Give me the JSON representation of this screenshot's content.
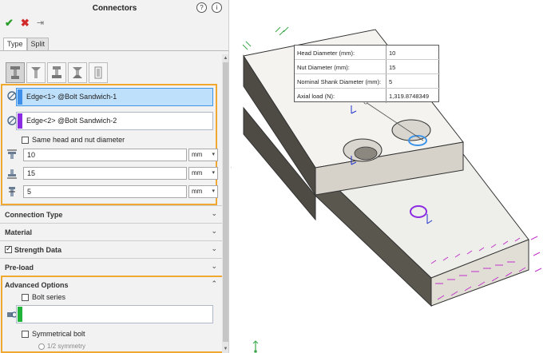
{
  "panel": {
    "title": "Connectors",
    "help_icon": "help-icon",
    "tooltip_icon": "tooltip-icon",
    "actions": {
      "ok": "✔",
      "cancel": "✖",
      "pin": "⇥"
    },
    "tabs": [
      {
        "label": "Type",
        "active": true
      },
      {
        "label": "Split",
        "active": false
      }
    ],
    "bolt_types": [
      "standard-bolt-icon",
      "countersink-bolt-icon",
      "counterbore-nut-icon",
      "countersink-nut-icon",
      "foundation-bolt-icon"
    ],
    "edge1": {
      "label": "Edge<1> @Bolt Sandwich-1",
      "color": "#3f8fe8"
    },
    "edge2": {
      "label": "Edge<2> @Bolt Sandwich-2",
      "color": "#8b2be2"
    },
    "same_diameter": {
      "label": "Same head and nut diameter",
      "checked": false
    },
    "head_diameter": {
      "value": "10",
      "unit": "mm"
    },
    "nut_diameter": {
      "value": "15",
      "unit": "mm"
    },
    "shank_diameter": {
      "value": "5",
      "unit": "mm"
    },
    "sections": {
      "connection_type": "Connection Type",
      "material": "Material",
      "strength_data": "Strength Data",
      "preload": "Pre-load",
      "advanced": "Advanced Options"
    },
    "strength_checked": true,
    "bolt_series": {
      "label": "Bolt series",
      "checked": false,
      "color": "#22b33a"
    },
    "symmetrical": {
      "label": "Symmetrical bolt",
      "checked": false
    },
    "half_symmetry": "1/2 symmetry"
  },
  "callout": {
    "rows": [
      {
        "label": "Head Diameter (mm):",
        "value": "10"
      },
      {
        "label": "Nut Diameter (mm):",
        "value": "15"
      },
      {
        "label": "Nominal Shank Diameter (mm):",
        "value": "5"
      },
      {
        "label": "Axial load (N):",
        "value": "1,319.8748349"
      }
    ]
  },
  "colors": {
    "accent_orange": "#f0a830",
    "selection_blue": "#3f95e8",
    "fixture_green": "#3aa84a",
    "load_magenta": "#c233c9"
  }
}
